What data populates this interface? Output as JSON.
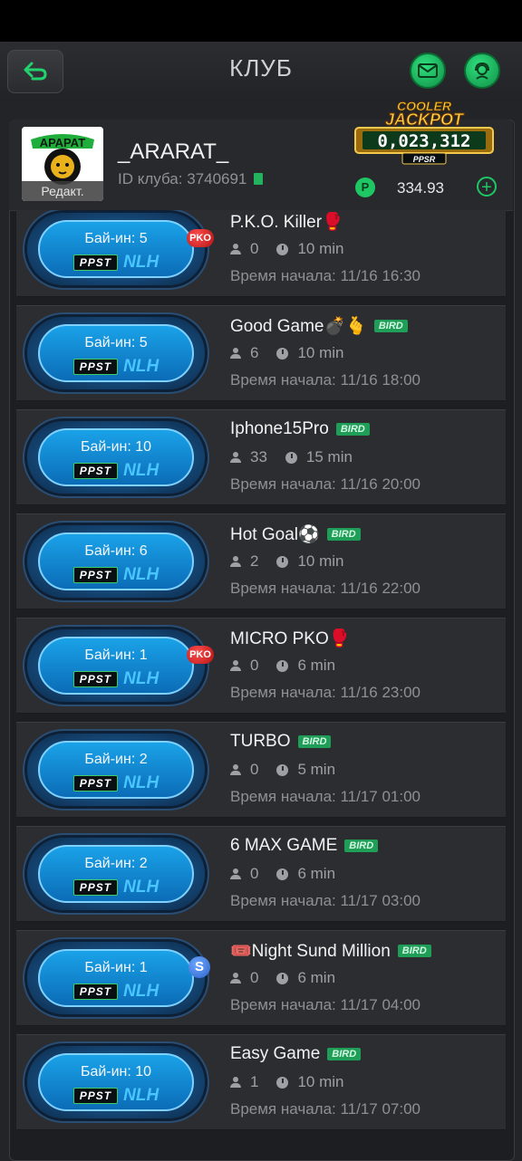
{
  "header": {
    "title": "КЛУБ"
  },
  "club": {
    "logo_text": "АРАРАТ",
    "edit_label": "Редакт.",
    "name": "_ARARAT_",
    "id_label": "ID клуба: 3740691"
  },
  "jackpot": {
    "line1": "COOLER",
    "line2": "JACKPOT",
    "amount": "0,023,312",
    "brand": "PPSR"
  },
  "balance": {
    "coin": "P",
    "value": "334.93",
    "add": "+"
  },
  "tournaments": [
    {
      "buyin": "Бай-ин: 5",
      "badge": "PPST",
      "game": "NLH",
      "tag": "PKO",
      "name": "P.K.O. Killer🥊",
      "bird": "",
      "players": "0",
      "duration": "10 min",
      "start": "Время начала: 11/16 16:30"
    },
    {
      "buyin": "Бай-ин: 5",
      "badge": "PPST",
      "game": "NLH",
      "tag": "",
      "name": "Good Game💣🫰",
      "bird": "BIRD",
      "players": "6",
      "duration": "10 min",
      "start": "Время начала: 11/16 18:00"
    },
    {
      "buyin": "Бай-ин: 10",
      "badge": "PPST",
      "game": "NLH",
      "tag": "",
      "name": "Iphone15Pro",
      "bird": "BIRD",
      "players": "33",
      "duration": "15 min",
      "start": "Время начала: 11/16 20:00"
    },
    {
      "buyin": "Бай-ин: 6",
      "badge": "PPST",
      "game": "NLH",
      "tag": "",
      "name": "Hot Goal⚽",
      "bird": "BIRD",
      "players": "2",
      "duration": "10 min",
      "start": "Время начала: 11/16 22:00"
    },
    {
      "buyin": "Бай-ин: 1",
      "badge": "PPST",
      "game": "NLH",
      "tag": "PKO",
      "name": "MICRO PKO🥊",
      "bird": "",
      "players": "0",
      "duration": "6 min",
      "start": "Время начала: 11/16 23:00"
    },
    {
      "buyin": "Бай-ин: 2",
      "badge": "PPST",
      "game": "NLH",
      "tag": "",
      "name": "TURBO",
      "bird": "BIRD",
      "players": "0",
      "duration": "5 min",
      "start": "Время начала: 11/17 01:00"
    },
    {
      "buyin": "Бай-ин: 2",
      "badge": "PPST",
      "game": "NLH",
      "tag": "",
      "name": "6 MAX GAME",
      "bird": "BIRD",
      "players": "0",
      "duration": "6 min",
      "start": "Время начала: 11/17 03:00"
    },
    {
      "buyin": "Бай-ин: 1",
      "badge": "PPST",
      "game": "NLH",
      "tag": "S",
      "name": "🎟️Night Sund Million",
      "bird": "BIRD",
      "players": "0",
      "duration": "6 min",
      "start": "Время начала: 11/17 04:00"
    },
    {
      "buyin": "Бай-ин: 10",
      "badge": "PPST",
      "game": "NLH",
      "tag": "",
      "name": "Easy Game",
      "bird": "BIRD",
      "players": "1",
      "duration": "10 min",
      "start": "Время начала: 11/17 07:00"
    }
  ]
}
